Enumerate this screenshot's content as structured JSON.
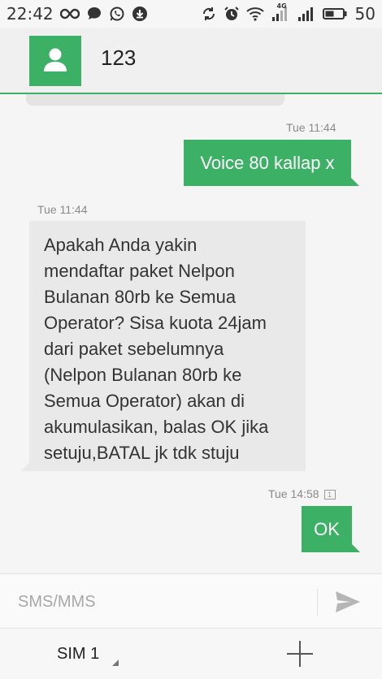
{
  "status_bar": {
    "time": "22:42",
    "battery_level": "50",
    "network_label": "4G",
    "left_icons": [
      "infinity-icon",
      "chat-bubble-icon",
      "whatsapp-icon",
      "download-icon"
    ],
    "right_icons": [
      "rotate-icon",
      "alarm-icon",
      "wifi-icon",
      "signal-icon",
      "signal-icon",
      "battery-icon"
    ]
  },
  "header": {
    "contact_name": "123",
    "avatar_icon": "person-icon",
    "accent_color": "#3cb064"
  },
  "messages": [
    {
      "direction": "outgoing",
      "timestamp": "Tue 11:44",
      "text": "Voice 80 kallap x"
    },
    {
      "direction": "incoming",
      "timestamp": "Tue 11:44",
      "lines": [
        "Apakah Anda yakin",
        "mendaftar paket Nelpon",
        "Bulanan 80rb ke Semua",
        "Operator? Sisa kuota 24jam",
        "dari paket sebelumnya",
        "(Nelpon Bulanan 80rb ke",
        "Semua Operator) akan di",
        "akumulasikan, balas OK jika",
        "setuju,BATAL jk tdk stuju"
      ]
    },
    {
      "direction": "outgoing",
      "timestamp": "Tue 14:58",
      "sim_tag": "1",
      "text": "OK"
    }
  ],
  "compose": {
    "placeholder": "SMS/MMS",
    "send_icon": "send-icon"
  },
  "bottom_bar": {
    "sim_label": "SIM 1",
    "add_icon": "plus-icon"
  }
}
